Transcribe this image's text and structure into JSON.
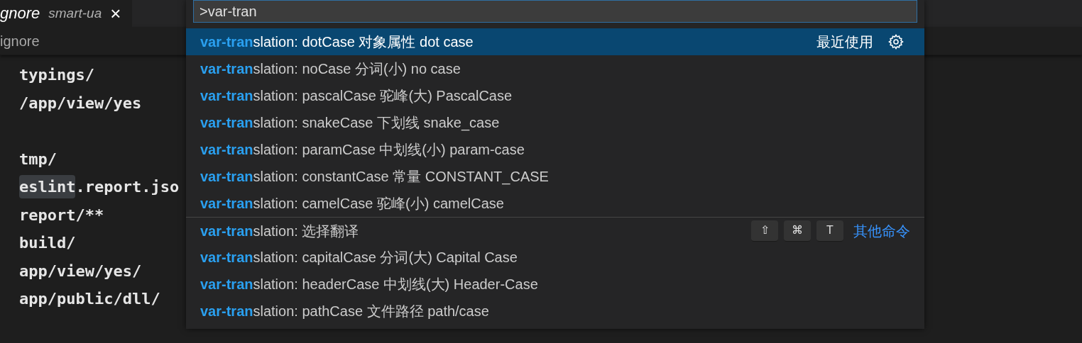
{
  "tab": {
    "title": "gnore",
    "description": "smart-ua",
    "close": "×",
    "selected": true
  },
  "breadcrumb": "ignore",
  "editor_lines": [
    {
      "kind": "code",
      "segments": [
        {
          "text": "typings/",
          "highlighted": false
        }
      ]
    },
    {
      "kind": "code",
      "segments": [
        {
          "text": "/app/view/yes",
          "highlighted": false
        }
      ]
    },
    {
      "kind": "blank"
    },
    {
      "kind": "code",
      "segments": [
        {
          "text": "tmp/",
          "highlighted": false
        }
      ]
    },
    {
      "kind": "code",
      "segments": [
        {
          "text": "eslint",
          "highlighted": true
        },
        {
          "text": ".report.jso",
          "highlighted": false
        }
      ]
    },
    {
      "kind": "code",
      "segments": [
        {
          "text": "report/**",
          "highlighted": false
        }
      ]
    },
    {
      "kind": "code",
      "segments": [
        {
          "text": "build/",
          "highlighted": false
        }
      ]
    },
    {
      "kind": "code",
      "segments": [
        {
          "text": "app/view/yes/",
          "highlighted": false
        }
      ]
    },
    {
      "kind": "code",
      "segments": [
        {
          "text": "app/public/dll/",
          "highlighted": false
        }
      ]
    }
  ],
  "command_palette": {
    "input": {
      "value": ">var-tran"
    },
    "items": [
      {
        "match": "var-tran",
        "rest": "slation: dotCase 对象属性 dot case",
        "selected": true,
        "group_label": "最近使用"
      },
      {
        "match": "var-tran",
        "rest": "slation: noCase 分词(小) no case",
        "selected": false
      },
      {
        "match": "var-tran",
        "rest": "slation: pascalCase 驼峰(大) PascalCase",
        "selected": false
      },
      {
        "match": "var-tran",
        "rest": "slation: snakeCase 下划线 snake_case",
        "selected": false
      },
      {
        "match": "var-tran",
        "rest": "slation: paramCase 中划线(小) param-case",
        "selected": false
      },
      {
        "match": "var-tran",
        "rest": "slation: constantCase 常量 CONSTANT_CASE",
        "selected": false
      },
      {
        "match": "var-tran",
        "rest": "slation: camelCase 驼峰(小) camelCase",
        "selected": false
      },
      {
        "match": "var-tran",
        "rest": "slation: 选择翻译",
        "selected": false,
        "separator_before": true,
        "keys": [
          "⇧",
          "⌘",
          "T"
        ],
        "group_label": "其他命令"
      },
      {
        "match": "var-tran",
        "rest": "slation: capitalCase 分词(大) Capital Case",
        "selected": false
      },
      {
        "match": "var-tran",
        "rest": "slation: headerCase 中划线(大) Header-Case",
        "selected": false
      },
      {
        "match": "var-tran",
        "rest": "slation: pathCase 文件路径 path/case",
        "selected": false
      }
    ]
  }
}
